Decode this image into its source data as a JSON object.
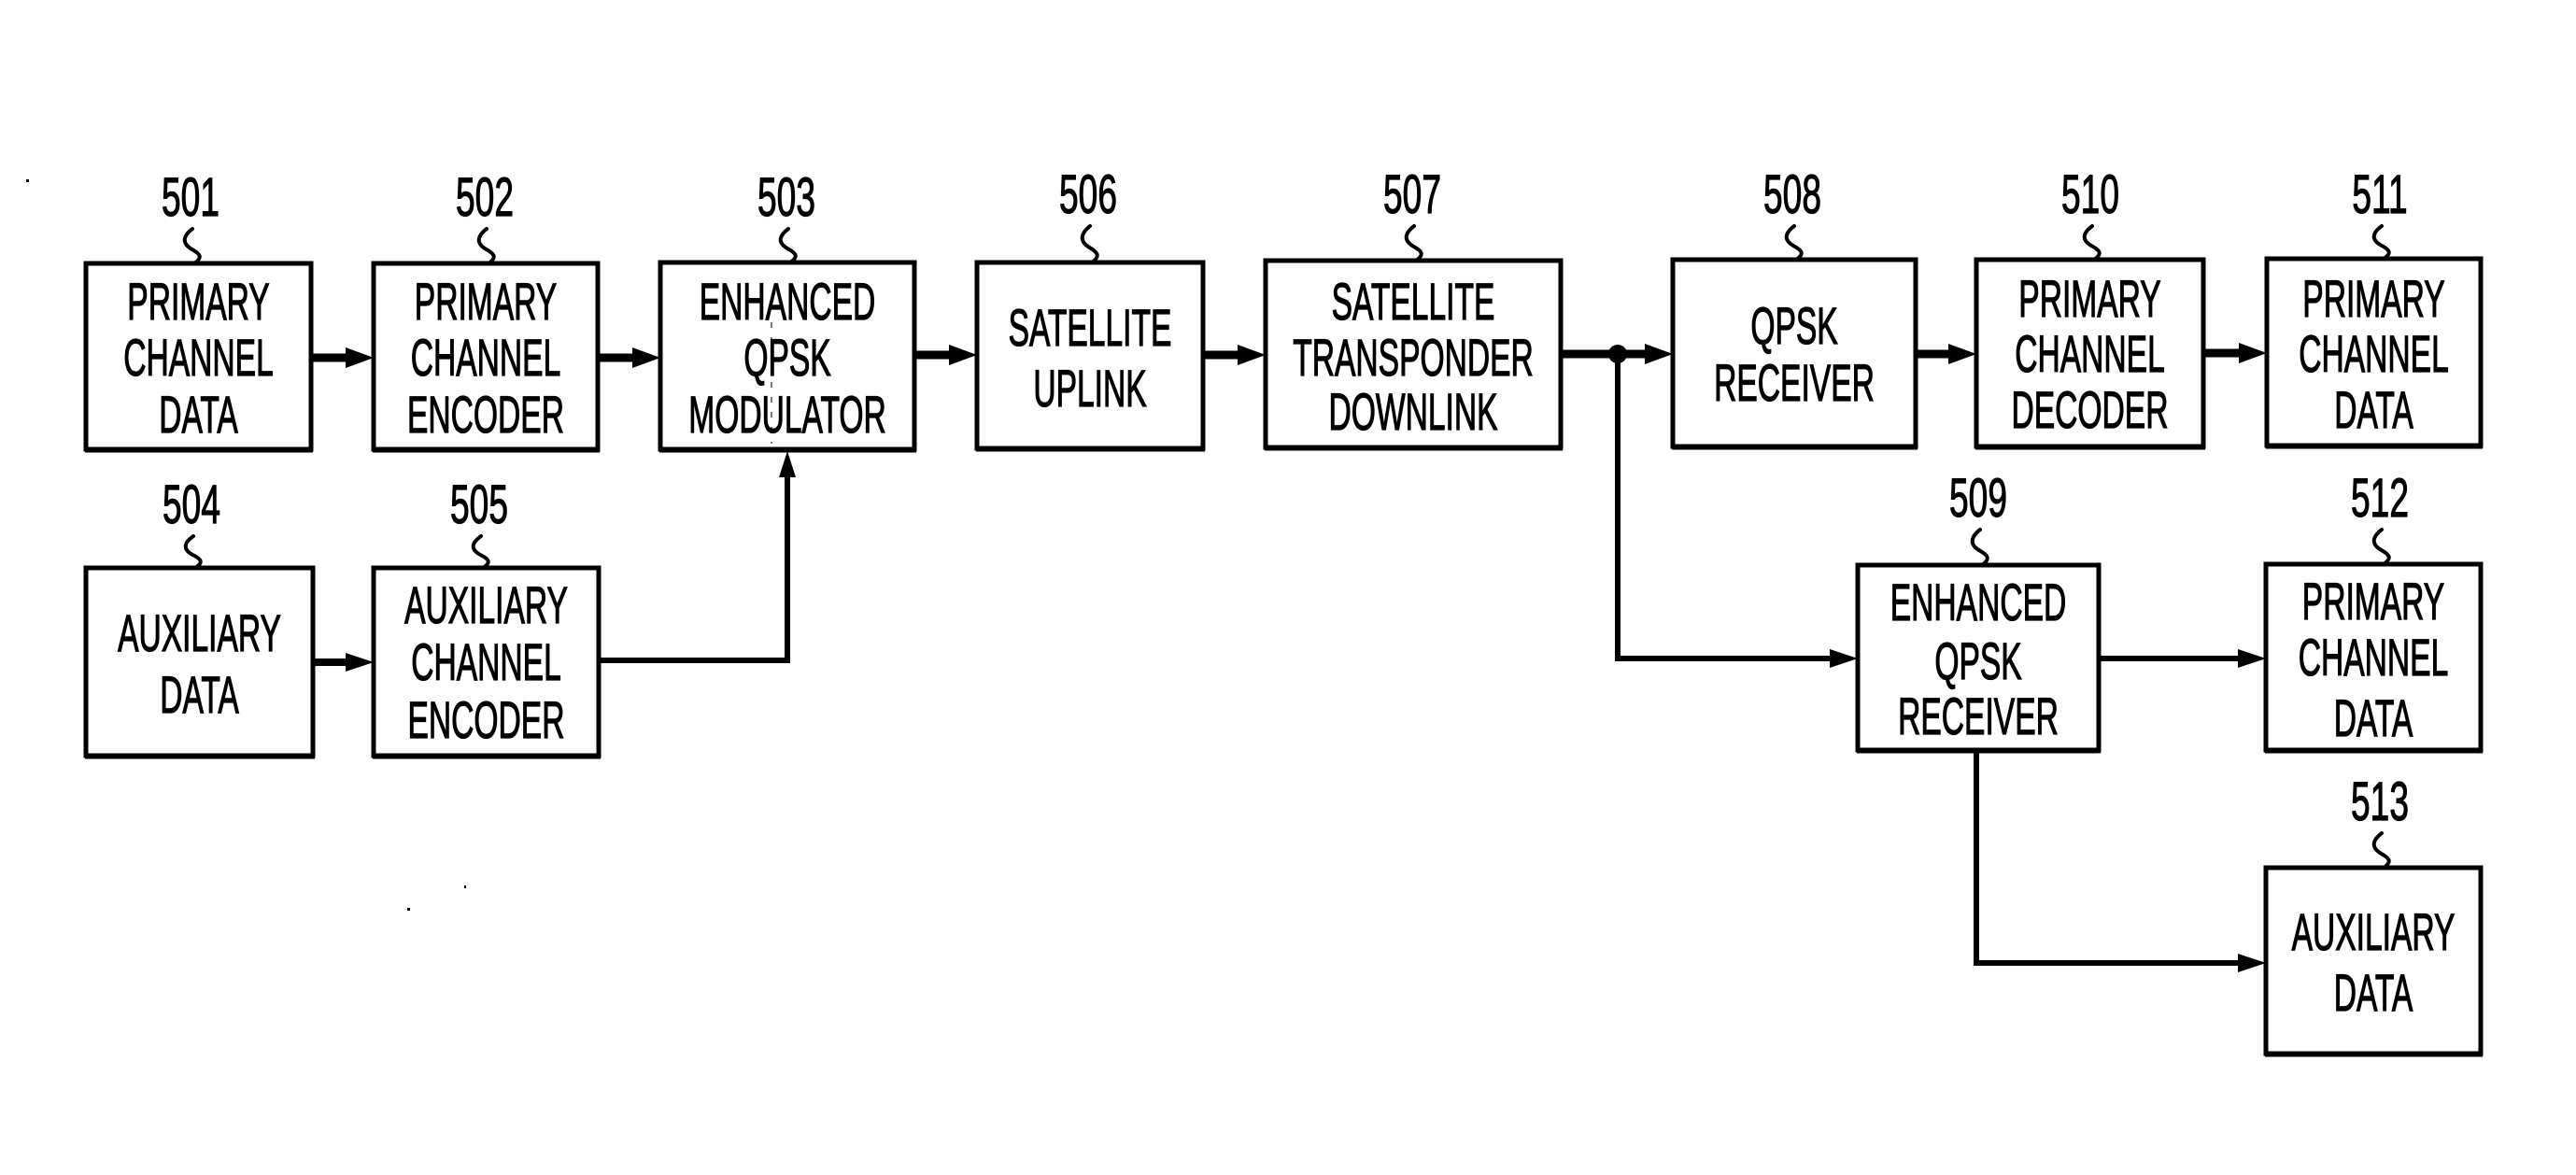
{
  "figure": {
    "description": "Block diagram of satellite transmission system with enhanced QPSK modulation carrying primary and auxiliary channels",
    "colors": {
      "ink": "#000000",
      "paper": "#ffffff"
    }
  },
  "blocks": [
    {
      "id": "501",
      "ref_label": "501",
      "lines": [
        "PRIMARY",
        "CHANNEL",
        "DATA"
      ]
    },
    {
      "id": "502",
      "ref_label": "502",
      "lines": [
        "PRIMARY",
        "CHANNEL",
        "ENCODER"
      ]
    },
    {
      "id": "503",
      "ref_label": "503",
      "lines": [
        "ENHANCED",
        "QPSK",
        "MODULATOR"
      ]
    },
    {
      "id": "504",
      "ref_label": "504",
      "lines": [
        "AUXILIARY",
        "DATA"
      ]
    },
    {
      "id": "505",
      "ref_label": "505",
      "lines": [
        "AUXILIARY",
        "CHANNEL",
        "ENCODER"
      ]
    },
    {
      "id": "506",
      "ref_label": "506",
      "lines": [
        "SATELLITE",
        "UPLINK"
      ]
    },
    {
      "id": "507",
      "ref_label": "507",
      "lines": [
        "SATELLITE",
        "TRANSPONDER",
        "DOWNLINK"
      ]
    },
    {
      "id": "508",
      "ref_label": "508",
      "lines": [
        "QPSK",
        "RECEIVER"
      ]
    },
    {
      "id": "509",
      "ref_label": "509",
      "lines": [
        "ENHANCED",
        "QPSK",
        "RECEIVER"
      ]
    },
    {
      "id": "510",
      "ref_label": "510",
      "lines": [
        "PRIMARY",
        "CHANNEL",
        "DECODER"
      ]
    },
    {
      "id": "511",
      "ref_label": "511",
      "lines": [
        "PRIMARY",
        "CHANNEL",
        "DATA"
      ]
    },
    {
      "id": "512",
      "ref_label": "512",
      "lines": [
        "PRIMARY",
        "CHANNEL",
        "DATA"
      ]
    },
    {
      "id": "513",
      "ref_label": "513",
      "lines": [
        "AUXILIARY",
        "DATA"
      ]
    }
  ],
  "connections": [
    {
      "from": "501",
      "to": "502"
    },
    {
      "from": "502",
      "to": "503"
    },
    {
      "from": "504",
      "to": "505"
    },
    {
      "from": "505",
      "to": "503"
    },
    {
      "from": "503",
      "to": "506"
    },
    {
      "from": "506",
      "to": "507"
    },
    {
      "from": "507",
      "to": "508"
    },
    {
      "from": "507",
      "to": "509"
    },
    {
      "from": "508",
      "to": "510"
    },
    {
      "from": "510",
      "to": "511"
    },
    {
      "from": "509",
      "to": "512"
    },
    {
      "from": "509",
      "to": "513"
    }
  ]
}
